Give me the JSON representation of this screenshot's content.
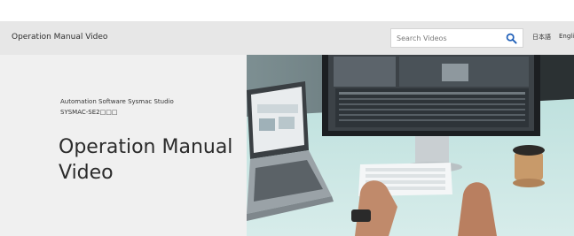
{
  "header": {
    "site_title": "Operation Manual Video",
    "search_placeholder": "Search Videos",
    "lang_japanese": "日本語",
    "lang_english": "English"
  },
  "hero": {
    "subtitle": "Automation Software Sysmac Studio",
    "product": "SYSMAC-SE2□□□",
    "title": "Operation Manual Video"
  }
}
